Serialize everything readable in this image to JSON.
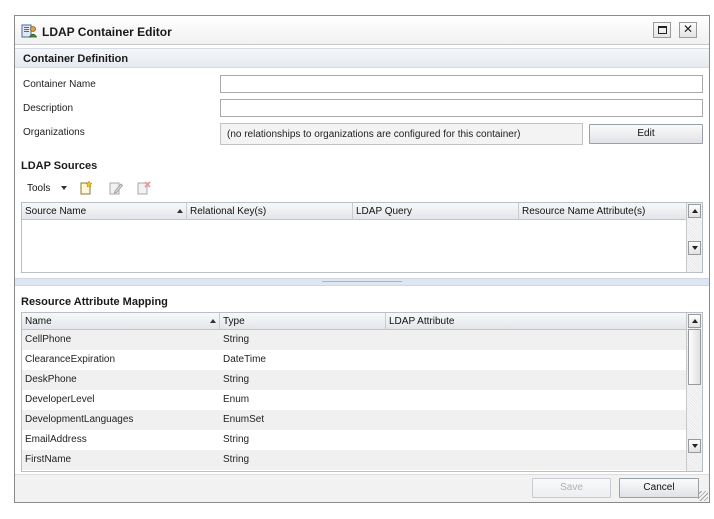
{
  "window": {
    "title": "LDAP Container Editor",
    "close_glyph": "✕"
  },
  "container_definition": {
    "heading": "Container Definition",
    "container_name_label": "Container Name",
    "container_name_value": "",
    "description_label": "Description",
    "description_value": "",
    "organizations_label": "Organizations",
    "organizations_text": "(no relationships to organizations are configured for this container)",
    "edit_button": "Edit"
  },
  "ldap_sources": {
    "heading": "LDAP Sources",
    "tools_label": "Tools",
    "toolbar_icons": [
      "add-source-icon",
      "edit-source-icon",
      "delete-source-icon"
    ],
    "columns": [
      "Source Name",
      "Relational Key(s)",
      "LDAP Query",
      "Resource Name Attribute(s)"
    ],
    "rows": []
  },
  "attribute_mapping": {
    "heading": "Resource Attribute Mapping",
    "columns": [
      "Name",
      "Type",
      "LDAP Attribute"
    ],
    "rows": [
      {
        "name": "CellPhone",
        "type": "String",
        "ldap": ""
      },
      {
        "name": "ClearanceExpiration",
        "type": "DateTime",
        "ldap": ""
      },
      {
        "name": "DeskPhone",
        "type": "String",
        "ldap": ""
      },
      {
        "name": "DeveloperLevel",
        "type": "Enum",
        "ldap": ""
      },
      {
        "name": "DevelopmentLanguages",
        "type": "EnumSet",
        "ldap": ""
      },
      {
        "name": "EmailAddress",
        "type": "String",
        "ldap": ""
      },
      {
        "name": "FirstName",
        "type": "String",
        "ldap": ""
      }
    ]
  },
  "footer": {
    "save_button": "Save",
    "cancel_button": "Cancel"
  },
  "colors": {
    "row_alt": "#f0f0f0",
    "section_band": "#e6eaf0",
    "splitter": "#dde6f2"
  }
}
